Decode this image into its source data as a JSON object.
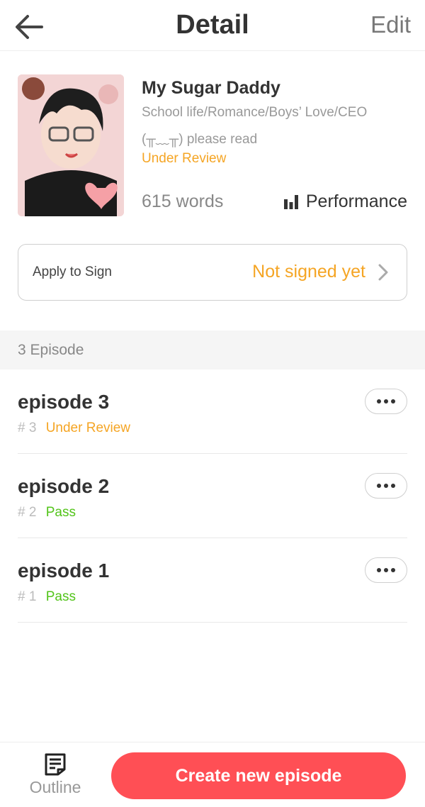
{
  "header": {
    "title": "Detail",
    "edit_label": "Edit",
    "back_icon": "arrow-left-icon"
  },
  "book": {
    "title": "My Sugar Daddy",
    "genres": "School life/Romance/Boys’ Love/CEO",
    "description": "(╥﹏╥) please read",
    "status": "Under Review",
    "words": "615 words",
    "performance_label": "Performance",
    "performance_icon": "bar-chart-icon"
  },
  "apply": {
    "label": "Apply to Sign",
    "value": "Not signed yet"
  },
  "episodes_header": "3 Episode",
  "episodes": [
    {
      "title": "episode 3",
      "number": "# 3",
      "status": "Under Review"
    },
    {
      "title": "episode 2",
      "number": "# 2",
      "status": "Pass"
    },
    {
      "title": "episode 1",
      "number": "# 1",
      "status": "Pass"
    }
  ],
  "bottom": {
    "outline_label": "Outline",
    "create_label": "Create new episode"
  },
  "colors": {
    "accent_orange": "#f5a524",
    "pass_green": "#52c41a",
    "primary_red": "#ff4f55"
  }
}
